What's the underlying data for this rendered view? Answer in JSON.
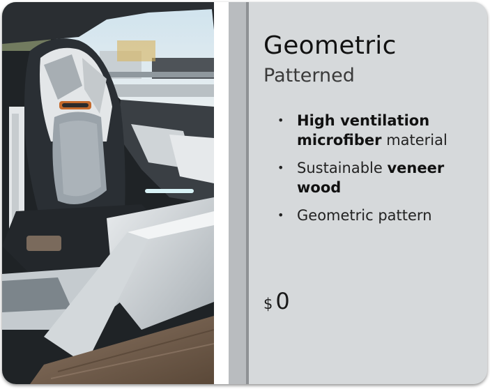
{
  "option": {
    "title": "Geometric",
    "subtitle": "Patterned",
    "features": [
      {
        "parts": [
          {
            "text": "High ventilation microfiber",
            "bold": true
          },
          {
            "text": " material",
            "bold": false
          }
        ]
      },
      {
        "parts": [
          {
            "text": "Sustainable ",
            "bold": false
          },
          {
            "text": "veneer wood",
            "bold": true
          }
        ]
      },
      {
        "parts": [
          {
            "text": "Geometric pattern",
            "bold": false
          }
        ]
      }
    ],
    "price": {
      "currency": "$",
      "amount": "0"
    }
  },
  "image": {
    "subject": "car-seat-interior",
    "colors": {
      "fabric": "#9aa3aa",
      "seat_dark": "#23272b",
      "wood": "#6b5848",
      "ambient_light": "#d8f2f6"
    }
  },
  "colors": {
    "panel_bg": "#d6d9db",
    "divider_grey": "#b9bcbf",
    "divider_line": "#8e9194",
    "text": "#111111"
  }
}
